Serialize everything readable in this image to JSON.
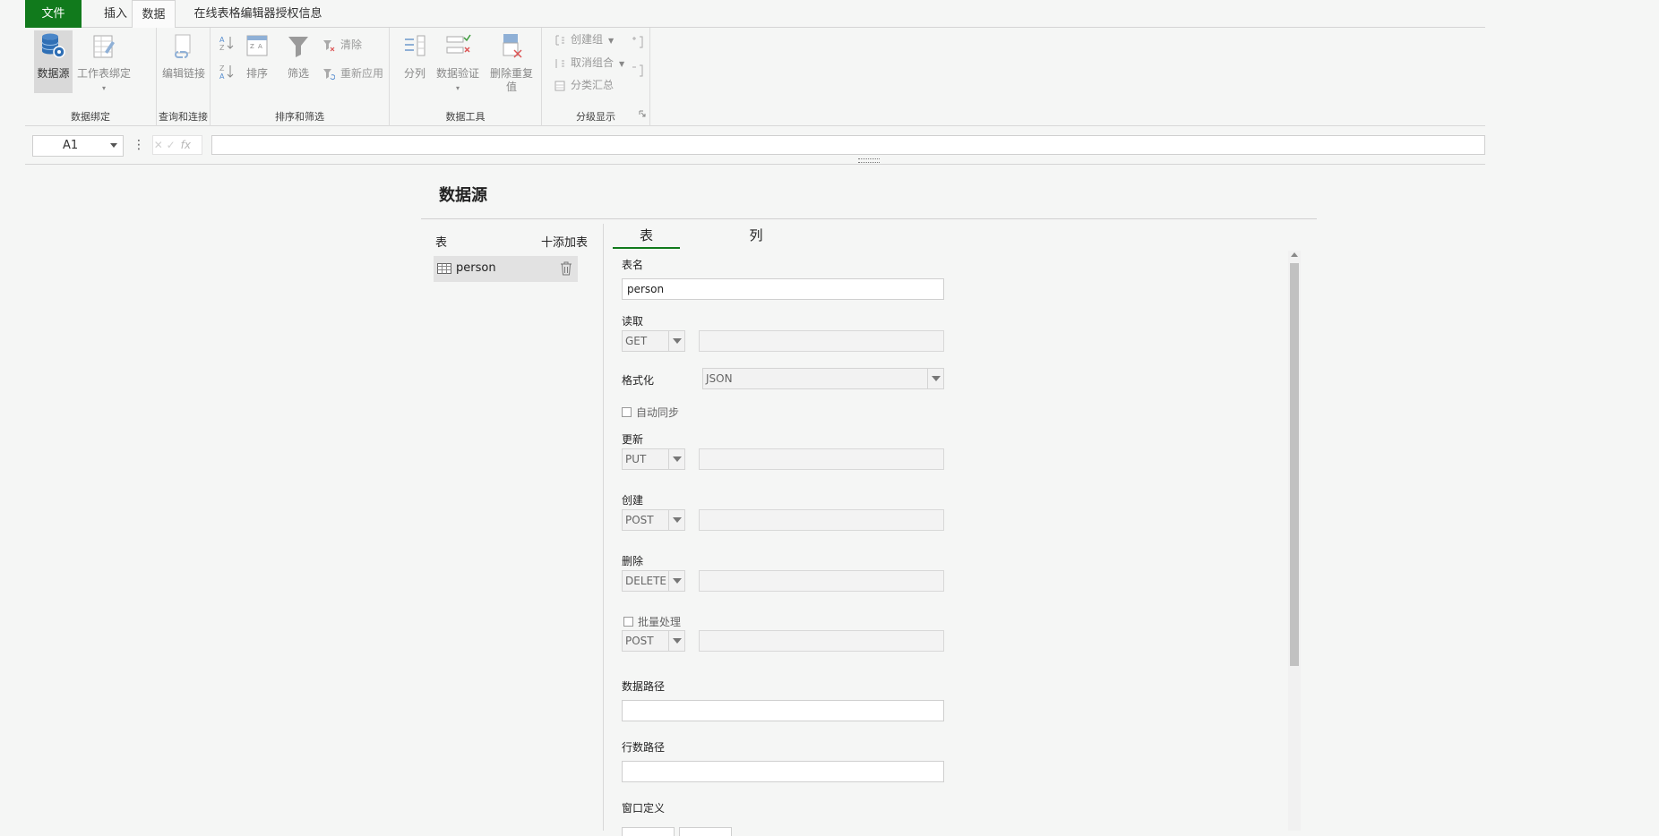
{
  "tabs": {
    "file": "文件",
    "insert": "插入",
    "data": "数据",
    "license": "在线表格编辑器授权信息"
  },
  "ribbon": {
    "binding": {
      "datasource": "数据源",
      "sheet_binding": "工作表绑定",
      "group_label": "数据绑定"
    },
    "query": {
      "edit_links": "编辑链接",
      "group_label": "查询和连接"
    },
    "sort_filter": {
      "sort": "排序",
      "filter": "筛选",
      "clear": "清除",
      "reapply": "重新应用",
      "group_label": "排序和筛选"
    },
    "tools": {
      "text_to_columns": "分列",
      "data_validation": "数据验证",
      "remove_duplicates": "删除重复值",
      "group_label": "数据工具"
    },
    "outline": {
      "group": "创建组",
      "ungroup": "取消组合",
      "subtotal": "分类汇总",
      "group_label": "分级显示"
    }
  },
  "formula_bar": {
    "name_box": "A1",
    "fx": "fx",
    "value": ""
  },
  "dialog": {
    "title": "数据源",
    "tables_header": "表",
    "add_table": "十添加表",
    "tables": [
      {
        "name": "person"
      }
    ],
    "subtabs": {
      "table": "表",
      "columns": "列"
    },
    "form": {
      "table_name_label": "表名",
      "table_name_value": "person",
      "read_label": "读取",
      "read_method": "GET",
      "read_url": "",
      "format_label": "格式化",
      "format_value": "JSON",
      "auto_sync_label": "自动同步",
      "auto_sync_checked": false,
      "update_label": "更新",
      "update_method": "PUT",
      "update_url": "",
      "create_label": "创建",
      "create_method": "POST",
      "create_url": "",
      "delete_label": "删除",
      "delete_method": "DELETE",
      "delete_url": "",
      "batch_label": "批量处理",
      "batch_checked": false,
      "batch_method": "POST",
      "batch_url": "",
      "data_path_label": "数据路径",
      "data_path_value": "",
      "row_count_path_label": "行数路径",
      "row_count_path_value": "",
      "window_def_label": "窗口定义"
    }
  },
  "colors": {
    "accent": "#117a1c",
    "active_bg": "#d9d9d9",
    "icon_blue": "#4a86c8"
  }
}
